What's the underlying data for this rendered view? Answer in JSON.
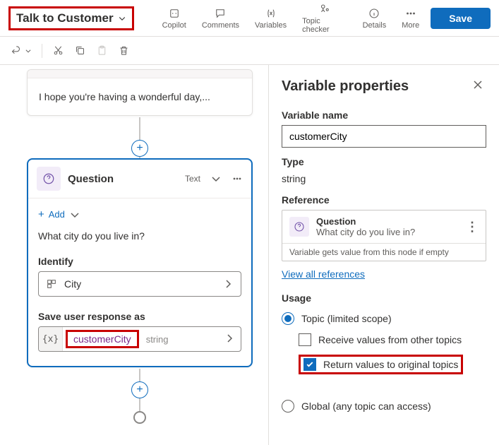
{
  "header": {
    "topic_name": "Talk to Customer",
    "tools": {
      "copilot": "Copilot",
      "comments": "Comments",
      "variables": "Variables",
      "topic_checker": "Topic checker",
      "details": "Details",
      "more": "More"
    },
    "save": "Save"
  },
  "canvas": {
    "message_node": {
      "text": "I hope you're having a wonderful day,..."
    },
    "question_node": {
      "title": "Question",
      "type_tag": "Text",
      "add_label": "Add",
      "prompt": "What city do you live in?",
      "identify_label": "Identify",
      "identify_value": "City",
      "save_label": "Save user response as",
      "var_name": "customerCity",
      "var_type": "string"
    }
  },
  "panel": {
    "title": "Variable properties",
    "var_name_label": "Variable name",
    "var_name_value": "customerCity",
    "type_label": "Type",
    "type_value": "string",
    "reference_label": "Reference",
    "reference": {
      "kind": "Question",
      "text": "What city do you live in?",
      "footer": "Variable gets value from this node if empty"
    },
    "view_all": "View all references",
    "usage_label": "Usage",
    "usage": {
      "topic_scope": "Topic (limited scope)",
      "receive": "Receive values from other topics",
      "return": "Return values to original topics",
      "global": "Global (any topic can access)"
    }
  }
}
